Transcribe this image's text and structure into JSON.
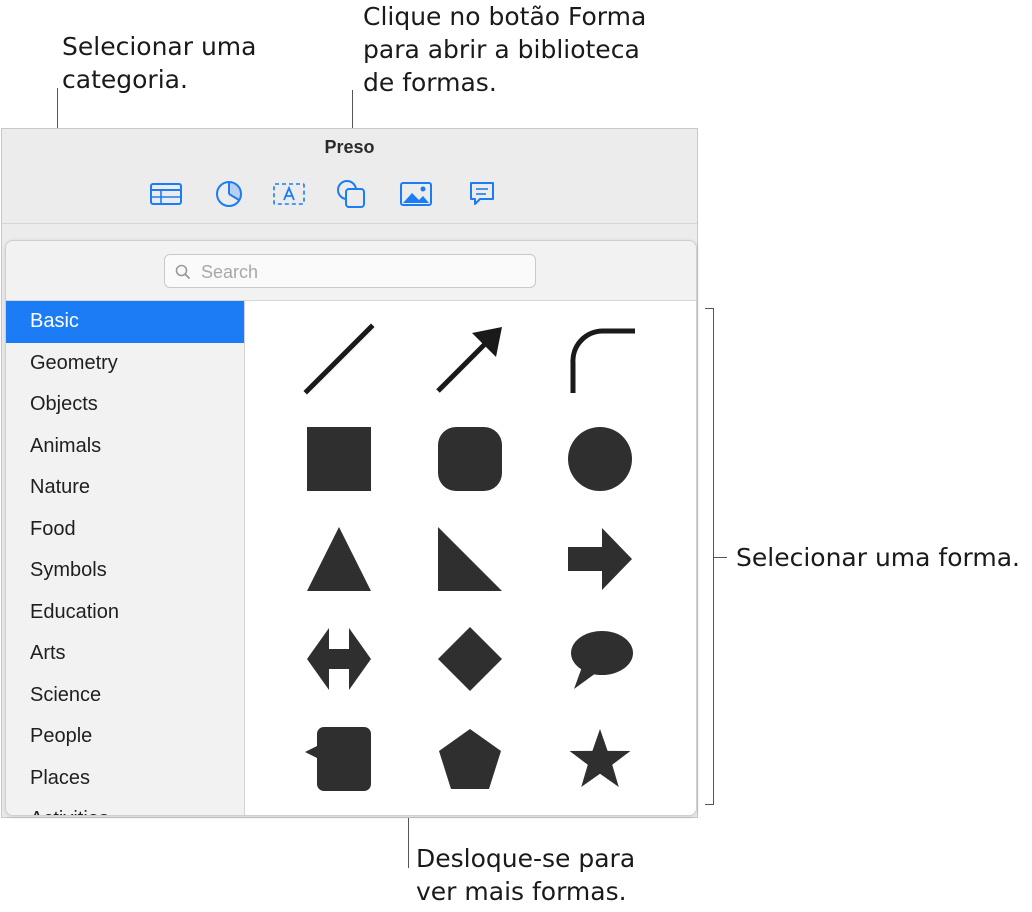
{
  "callouts": {
    "category": [
      "Selecionar uma",
      "categoria."
    ],
    "shape_button": [
      "Clique no botão Forma",
      "para abrir a biblioteca",
      "de formas."
    ],
    "select_shape": [
      "Selecionar uma forma."
    ],
    "scroll": [
      "Desloque-se para",
      "ver mais formas."
    ]
  },
  "window": {
    "title": "Preso",
    "toolbar": [
      {
        "name": "table-icon"
      },
      {
        "name": "chart-icon"
      },
      {
        "name": "text-icon"
      },
      {
        "name": "shape-icon"
      },
      {
        "name": "media-icon"
      },
      {
        "name": "comment-icon"
      }
    ],
    "accent_color": "#1c7cf5"
  },
  "popover": {
    "search_placeholder": "Search",
    "categories": [
      "Basic",
      "Geometry",
      "Objects",
      "Animals",
      "Nature",
      "Food",
      "Symbols",
      "Education",
      "Arts",
      "Science",
      "People",
      "Places",
      "Activities"
    ],
    "selected_category": "Basic",
    "shapes": [
      "line",
      "arrow-line",
      "curve",
      "square",
      "rounded-square",
      "circle",
      "triangle",
      "right-triangle",
      "arrow",
      "double-arrow",
      "diamond",
      "speech-bubble",
      "callout-square",
      "pentagon",
      "star"
    ]
  }
}
